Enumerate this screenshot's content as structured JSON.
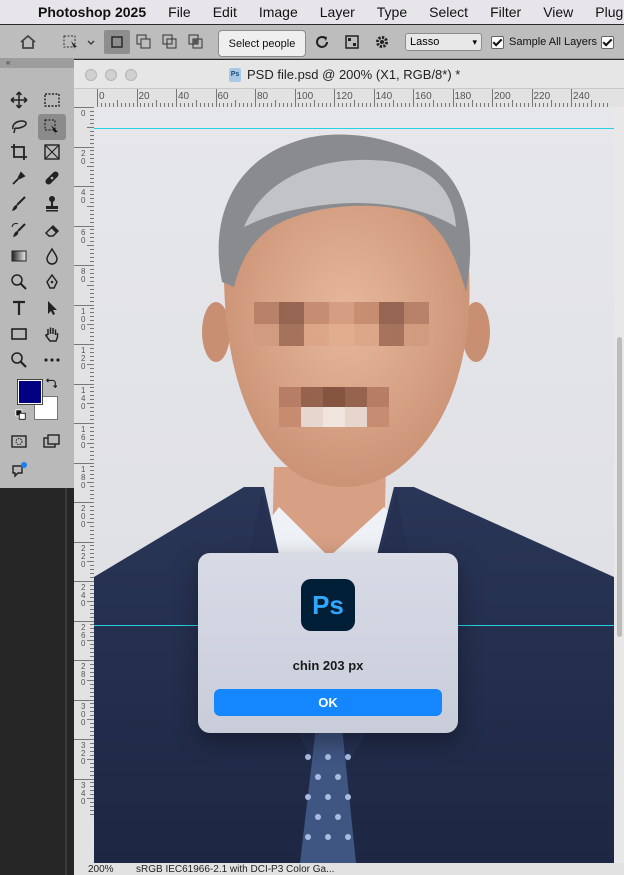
{
  "menubar": {
    "app_name": "Photoshop 2025",
    "items": [
      "File",
      "Edit",
      "Image",
      "Layer",
      "Type",
      "Select",
      "Filter",
      "View",
      "Plugin"
    ]
  },
  "options_bar": {
    "select_people_label": "Select people",
    "mode_value": "Lasso",
    "sample_all_layers_label": "Sample All Layers",
    "sample_all_layers_checked": true,
    "second_checkbox_checked": true
  },
  "toolbar": {
    "collapse_label": "«",
    "foreground_color": "#000080",
    "background_color": "#ffffff"
  },
  "document": {
    "title": "PSD file.psd @ 200% (X1, RGB/8*) *",
    "ruler_h_labels": [
      "0",
      "20",
      "40",
      "60",
      "80",
      "100",
      "120",
      "140",
      "160",
      "180",
      "200",
      "220",
      "240"
    ],
    "ruler_v_labels": [
      "0",
      "2 0",
      "4 0",
      "6 0",
      "8 0",
      "1 0 0",
      "1 2 0",
      "1 4 0",
      "1 6 0",
      "1 8 0",
      "2 0 0",
      "2 2 0",
      "2 4 0",
      "2 6 0",
      "2 8 0",
      "3 0 0",
      "3 2 0",
      "3 4 0"
    ],
    "guide_color": "#27d3e0"
  },
  "statusbar": {
    "zoom": "200%",
    "profile": "sRGB IEC61966-2.1 with DCI-P3 Color Ga..."
  },
  "dialog": {
    "icon_text": "Ps",
    "message": "chin 203 px",
    "ok_label": "OK"
  }
}
